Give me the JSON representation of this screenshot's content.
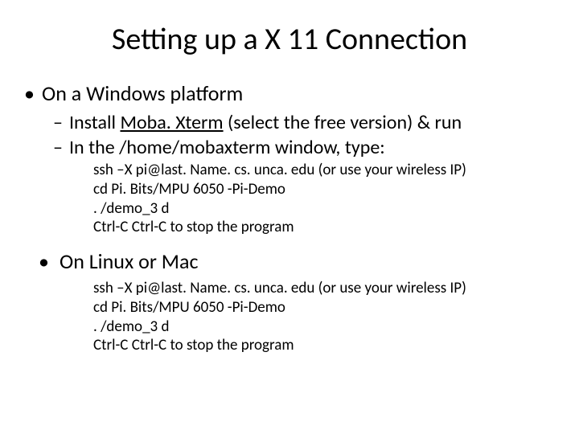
{
  "title": "Setting up a X 11 Connection",
  "section1": {
    "heading": "On a Windows platform",
    "sub1_pre": "Install ",
    "sub1_link": "Moba. Xterm",
    "sub1_post": " (select the free version) & run",
    "sub2": "In the /home/mobaxterm window, type:",
    "cmds": [
      "ssh –X pi@last. Name. cs. unca. edu (or use your wireless IP)",
      "cd Pi. Bits/MPU 6050 -Pi-Demo",
      ". /demo_3 d",
      "Ctrl-C Ctrl-C to stop the program"
    ]
  },
  "section2": {
    "heading": "On Linux or Mac",
    "cmds": [
      "ssh –X pi@last. Name. cs. unca. edu (or use your wireless IP)",
      "cd Pi. Bits/MPU 6050 -Pi-Demo",
      ". /demo_3 d",
      "Ctrl-C Ctrl-C to stop the program"
    ]
  }
}
